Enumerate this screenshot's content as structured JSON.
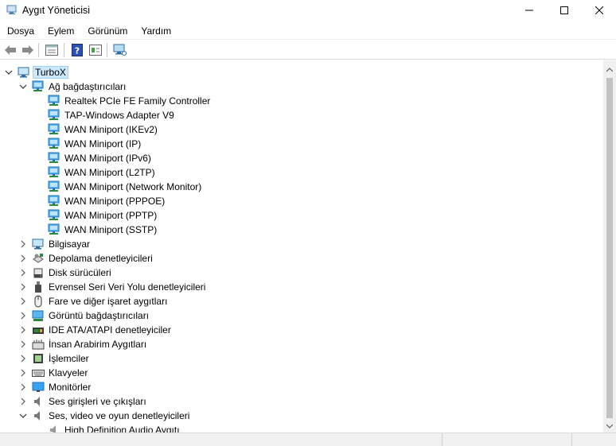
{
  "window": {
    "title": "Aygıt Yöneticisi"
  },
  "menu": [
    "Dosya",
    "Eylem",
    "Görünüm",
    "Yardım"
  ],
  "toolbar": [
    "back-icon",
    "forward-icon",
    "properties-icon",
    "help-icon",
    "update-driver-icon",
    "scan-hardware-icon"
  ],
  "tree": {
    "root": "TurboX",
    "network_adapters": {
      "label": "Ağ bağdaştırıcıları",
      "children": [
        "Realtek PCIe FE Family Controller",
        "TAP-Windows Adapter V9",
        "WAN Miniport (IKEv2)",
        "WAN Miniport (IP)",
        "WAN Miniport (IPv6)",
        "WAN Miniport (L2TP)",
        "WAN Miniport (Network Monitor)",
        "WAN Miniport (PPPOE)",
        "WAN Miniport (PPTP)",
        "WAN Miniport (SSTP)"
      ]
    },
    "categories": [
      {
        "label": "Bilgisayar",
        "icon": "computer-icon"
      },
      {
        "label": "Depolama denetleyicileri",
        "icon": "storage-controller-icon"
      },
      {
        "label": "Disk sürücüleri",
        "icon": "disk-drive-icon"
      },
      {
        "label": "Evrensel Seri Veri Yolu denetleyicileri",
        "icon": "usb-icon"
      },
      {
        "label": "Fare ve diğer işaret aygıtları",
        "icon": "mouse-icon"
      },
      {
        "label": "Görüntü bağdaştırıcıları",
        "icon": "display-adapter-icon"
      },
      {
        "label": "IDE ATA/ATAPI denetleyiciler",
        "icon": "ide-controller-icon"
      },
      {
        "label": "İnsan Arabirim Aygıtları",
        "icon": "hid-icon"
      },
      {
        "label": "İşlemciler",
        "icon": "processor-icon"
      },
      {
        "label": "Klavyeler",
        "icon": "keyboard-icon"
      },
      {
        "label": "Monitörler",
        "icon": "monitor-icon"
      },
      {
        "label": "Ses girişleri ve çıkışları",
        "icon": "audio-io-icon"
      }
    ],
    "sound": {
      "label": "Ses, video ve oyun denetleyicileri",
      "children": [
        "High Definition Audio Aygıtı"
      ]
    }
  },
  "colors": {
    "selection": "#cce8ff",
    "network_icon": "#1e88e5"
  }
}
